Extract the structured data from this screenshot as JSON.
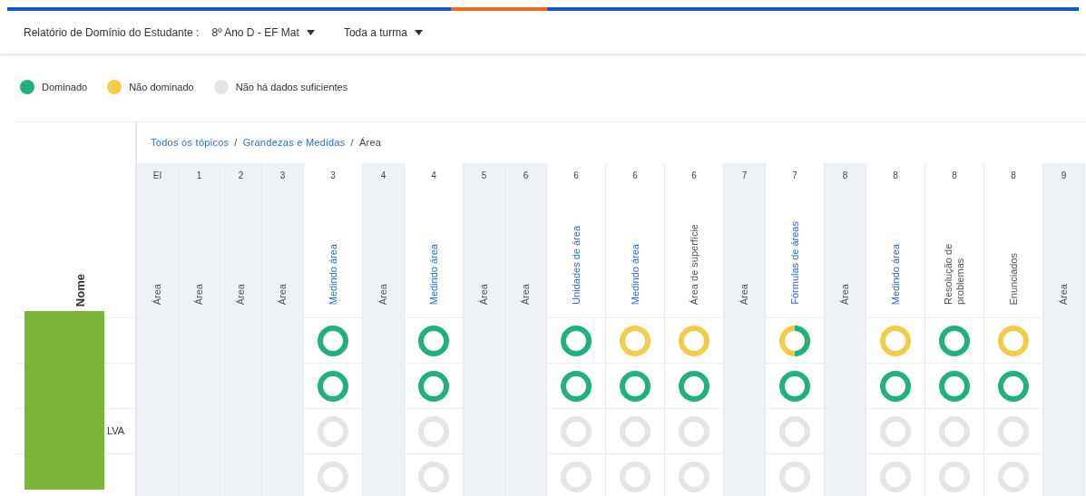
{
  "header": {
    "label": "Relatório de Domínio do Estudante :",
    "class_select": "8º Ano D - EF Mat",
    "group_select": "Toda a turma"
  },
  "legend": [
    {
      "label": "Dominado",
      "color": "#22b07d"
    },
    {
      "label": "Não dominado",
      "color": "#f2cd4b"
    },
    {
      "label": "Não há dados suficientes",
      "color": "#e3e5e8"
    }
  ],
  "breadcrumb": [
    {
      "label": "Todos os tópicos",
      "link": true
    },
    {
      "separator": "/",
      "label": "Grandezas e Medidas",
      "link": true
    },
    {
      "separator": "/",
      "label": "Área",
      "link": false
    }
  ],
  "name_header": "Nome",
  "columns": [
    {
      "grade": "EI",
      "label": "Área",
      "kind": "area"
    },
    {
      "grade": "1",
      "label": "Área",
      "kind": "area"
    },
    {
      "grade": "2",
      "label": "Área",
      "kind": "area"
    },
    {
      "grade": "3",
      "label": "Área",
      "kind": "area"
    },
    {
      "grade": "3",
      "label": "Medindo área",
      "kind": "topic",
      "link": true
    },
    {
      "grade": "4",
      "label": "Área",
      "kind": "area"
    },
    {
      "grade": "4",
      "label": "Medindo área",
      "kind": "topic",
      "link": true
    },
    {
      "grade": "5",
      "label": "Área",
      "kind": "area"
    },
    {
      "grade": "6",
      "label": "Área",
      "kind": "area"
    },
    {
      "grade": "6",
      "label": "Unidades de área",
      "kind": "topic",
      "link": true
    },
    {
      "grade": "6",
      "label": "Medindo área",
      "kind": "topic",
      "link": true
    },
    {
      "grade": "6",
      "label": "Área de superfície",
      "kind": "topic",
      "link": false
    },
    {
      "grade": "7",
      "label": "Área",
      "kind": "area"
    },
    {
      "grade": "7",
      "label": "Fórmulas de áreas",
      "kind": "topic",
      "link": true
    },
    {
      "grade": "8",
      "label": "Área",
      "kind": "area"
    },
    {
      "grade": "8",
      "label": "Medindo área",
      "kind": "topic",
      "link": true
    },
    {
      "grade": "8",
      "label": "Resolução de problemas",
      "kind": "topic",
      "link": false
    },
    {
      "grade": "8",
      "label": "Enunciados",
      "kind": "topic",
      "link": false
    },
    {
      "grade": "9",
      "label": "Área",
      "kind": "area"
    }
  ],
  "rows": [
    {
      "cells": [
        {
          "kind": "mastered"
        },
        {
          "kind": "mastered"
        },
        {
          "kind": "mastered"
        },
        {
          "kind": "unmastered"
        },
        {
          "kind": "unmastered"
        },
        {
          "kind": "mixed"
        },
        {
          "kind": "unmastered"
        },
        {
          "kind": "mastered"
        },
        {
          "kind": "unmastered"
        }
      ]
    },
    {
      "cells": [
        {
          "kind": "mastered"
        },
        {
          "kind": "mastered"
        },
        {
          "kind": "mastered"
        },
        {
          "kind": "mastered"
        },
        {
          "kind": "mastered"
        },
        {
          "kind": "mastered"
        },
        {
          "kind": "mastered"
        },
        {
          "kind": "mastered"
        },
        {
          "kind": "mastered"
        }
      ]
    },
    {
      "name": "LVA",
      "cells": [
        {
          "kind": "nodata"
        },
        {
          "kind": "nodata"
        },
        {
          "kind": "nodata"
        },
        {
          "kind": "nodata"
        },
        {
          "kind": "nodata"
        },
        {
          "kind": "nodata"
        },
        {
          "kind": "nodata"
        },
        {
          "kind": "nodata"
        },
        {
          "kind": "nodata"
        }
      ]
    },
    {
      "cells": [
        {
          "kind": "nodata"
        },
        {
          "kind": "nodata"
        },
        {
          "kind": "nodata"
        },
        {
          "kind": "nodata"
        },
        {
          "kind": "nodata"
        },
        {
          "kind": "nodata"
        },
        {
          "kind": "nodata"
        },
        {
          "kind": "nodata"
        },
        {
          "kind": "nodata"
        }
      ]
    }
  ]
}
